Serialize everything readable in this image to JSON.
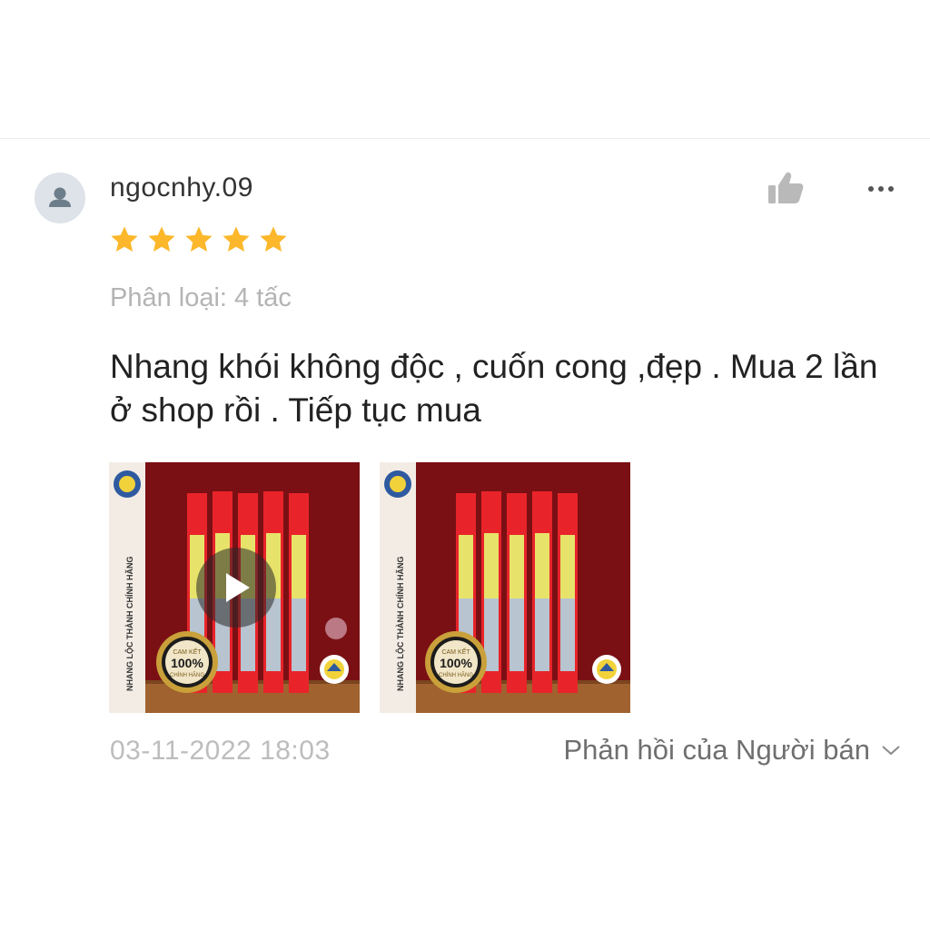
{
  "review": {
    "username": "ngocnhy.09",
    "rating": 5,
    "variation": "Phân loại: 4 tấc",
    "comment": "Nhang khói không độc , cuốn cong ,đẹp . Mua 2 lần ở shop rồi . Tiếp tục mua",
    "timestamp": "03-11-2022 18:03",
    "seller_reply_label": "Phản hồi của Người bán"
  },
  "media": [
    {
      "type": "video",
      "side_text": "NHANG LỘC THÀNH CHÍNH HÃNG",
      "badge_top": "CAM KẾT",
      "badge_value": "100%",
      "badge_bottom": "CHÍNH HÃNG"
    },
    {
      "type": "image",
      "side_text": "NHANG LỘC THÀNH CHÍNH HÃNG",
      "badge_top": "CAM KẾT",
      "badge_value": "100%",
      "badge_bottom": "CHÍNH HÃNG"
    }
  ],
  "icons": {
    "avatar": "user-silhouette-icon",
    "like": "thumbs-up-icon",
    "more": "more-horizontal-icon",
    "star": "star-icon",
    "play": "play-icon",
    "chevron": "chevron-down-icon"
  },
  "colors": {
    "star": "#fcb72a",
    "username": "#333333",
    "muted": "#b4b4b4",
    "body_text": "#222222",
    "product_bg": "#8a1616",
    "package_red": "#e8242a"
  }
}
